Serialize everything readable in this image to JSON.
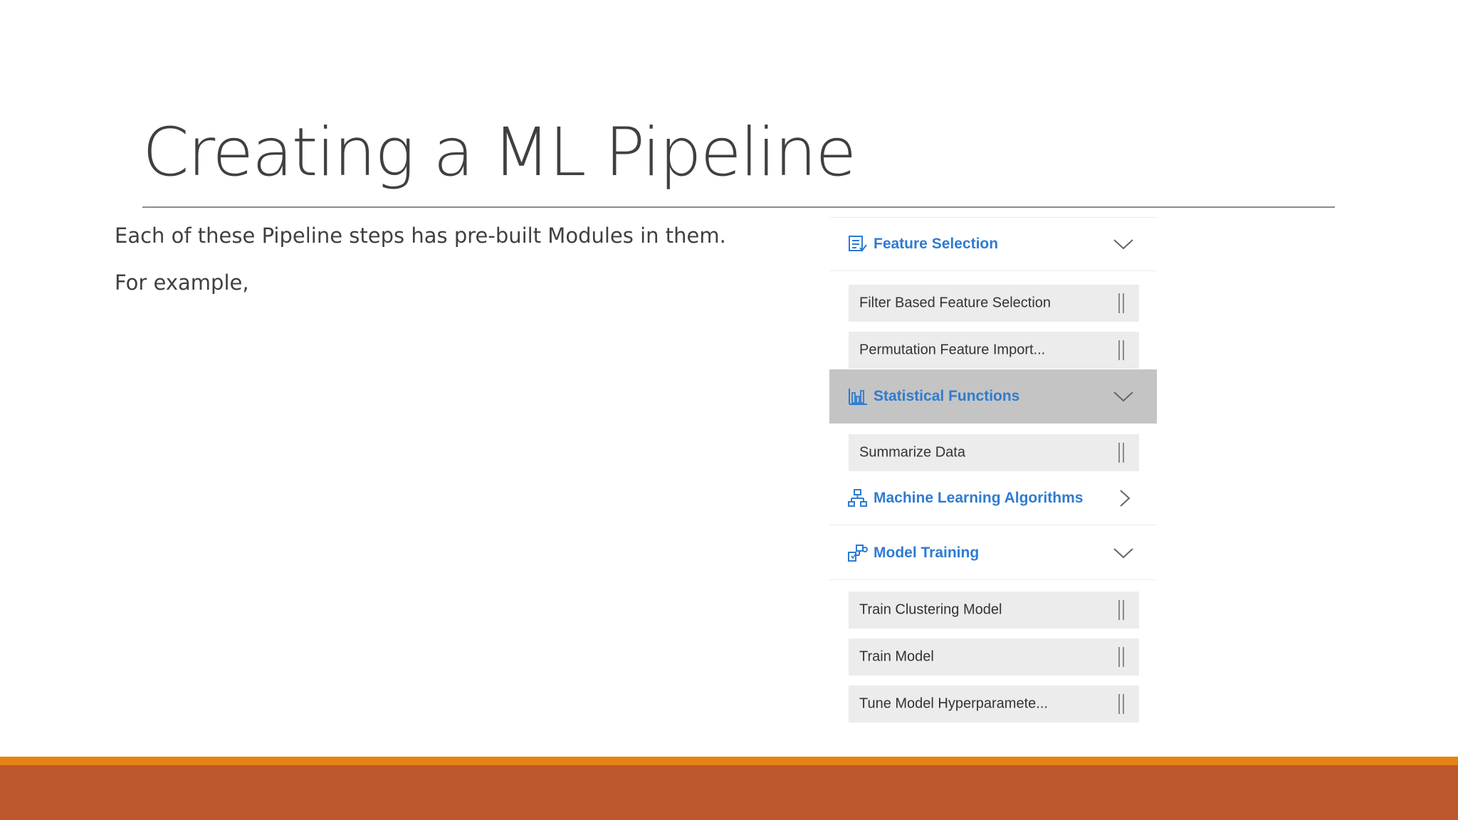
{
  "slide": {
    "title": "Creating a ML Pipeline",
    "body_lines": [
      "Each of these Pipeline steps has pre-built Modules in them.",
      "For example,"
    ]
  },
  "panel": {
    "feature_selection": {
      "label": "Feature Selection",
      "icon": "feature-selection-icon",
      "expanded": true,
      "items": [
        "Filter Based Feature Selection",
        "Permutation Feature Import..."
      ]
    },
    "statistical_functions": {
      "label": "Statistical Functions",
      "icon": "bar-chart-icon",
      "expanded": true,
      "selected": true,
      "items": [
        "Summarize Data"
      ]
    },
    "machine_learning_algorithms": {
      "label": "Machine Learning Algorithms",
      "icon": "hierarchy-icon",
      "expanded": false
    },
    "model_training": {
      "label": "Model Training",
      "icon": "model-training-icon",
      "expanded": true,
      "items": [
        "Train Clustering Model",
        "Train Model",
        "Tune Model Hyperparamete..."
      ]
    }
  },
  "colors": {
    "title_text": "#404040",
    "category_text": "#2f7bd1",
    "selected_row": "#c4c4c4",
    "module_bg": "#ececec",
    "bar_orange": "#e48312",
    "bar_rust": "#bd582c"
  }
}
